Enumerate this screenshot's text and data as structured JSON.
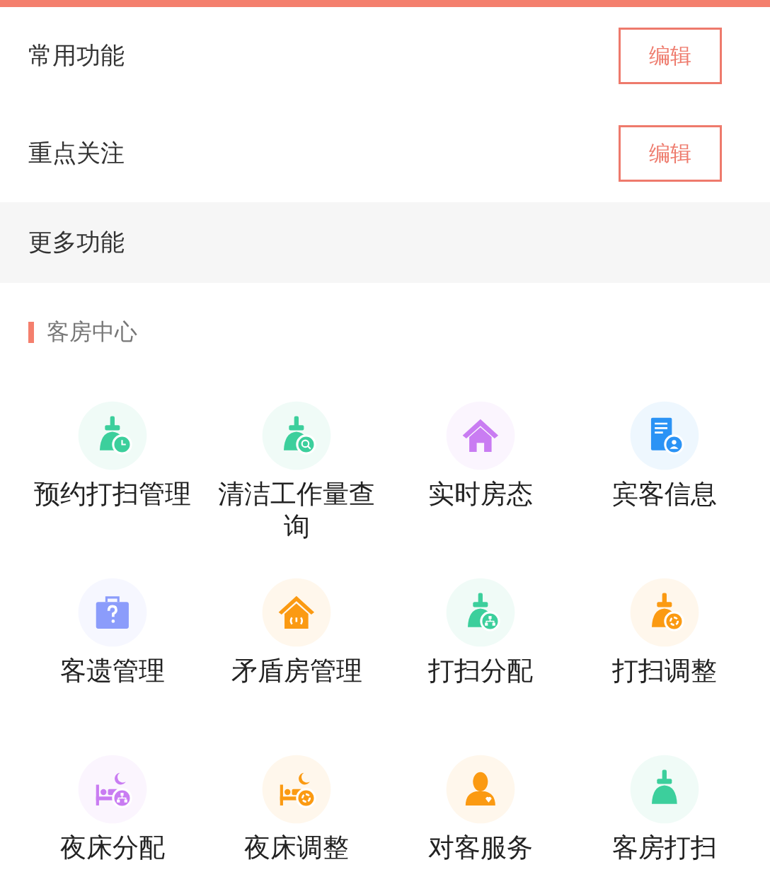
{
  "sections": [
    {
      "title": "常用功能",
      "button": "编辑",
      "shaded": false
    },
    {
      "title": "重点关注",
      "button": "编辑",
      "shaded": false
    },
    {
      "title": "更多功能",
      "shaded": true
    }
  ],
  "group": {
    "title": "客房中心",
    "items": [
      {
        "label": "预约打扫管理",
        "kind": "broom-clock",
        "color": "#3ccf9c"
      },
      {
        "label": "清洁工作量查询",
        "kind": "broom-search",
        "color": "#3ccf9c"
      },
      {
        "label": "实时房态",
        "kind": "house",
        "color": "#c97cf2"
      },
      {
        "label": "宾客信息",
        "kind": "document-person",
        "color": "#2b93f5"
      },
      {
        "label": "客遗管理",
        "kind": "briefcase-question",
        "color": "#8b9cfb"
      },
      {
        "label": "矛盾房管理",
        "kind": "house-arrows",
        "color": "#fb9a12"
      },
      {
        "label": "打扫分配",
        "kind": "broom-network",
        "color": "#3ccf9c"
      },
      {
        "label": "打扫调整",
        "kind": "broom-gear",
        "color": "#fb9a12"
      },
      {
        "label": "夜床分配",
        "kind": "bed-network",
        "color": "#c97cf2"
      },
      {
        "label": "夜床调整",
        "kind": "bed-gear",
        "color": "#fb9a12"
      },
      {
        "label": "对客服务",
        "kind": "person-heart",
        "color": "#fb9a12"
      },
      {
        "label": "客房打扫",
        "kind": "broom",
        "color": "#3ccf9c"
      }
    ]
  }
}
